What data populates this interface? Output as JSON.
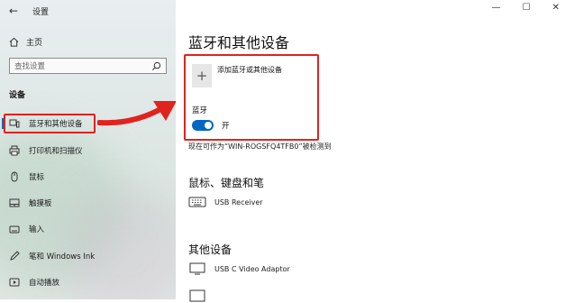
{
  "window": {
    "title": "设置",
    "back_glyph": "←",
    "controls": {
      "minimize": "—",
      "maximize": "☐",
      "close": "✕"
    }
  },
  "sidebar": {
    "home_label": "主页",
    "search_placeholder": "查找设置",
    "section": "设备",
    "items": [
      {
        "label": "蓝牙和其他设备",
        "icon": "bluetooth-devices-icon",
        "selected": true
      },
      {
        "label": "打印机和扫描仪",
        "icon": "printer-icon"
      },
      {
        "label": "鼠标",
        "icon": "mouse-icon"
      },
      {
        "label": "触摸板",
        "icon": "touchpad-icon"
      },
      {
        "label": "输入",
        "icon": "keyboard-icon"
      },
      {
        "label": "笔和 Windows Ink",
        "icon": "pen-icon"
      },
      {
        "label": "自动播放",
        "icon": "autoplay-icon"
      }
    ]
  },
  "main": {
    "title": "蓝牙和其他设备",
    "add_device_label": "添加蓝牙或其他设备",
    "bluetooth_label": "蓝牙",
    "bluetooth_state": "开",
    "bluetooth_on": true,
    "discoverable_text": "现在可作为“WIN-ROGSFQ4TFB0”被检测到",
    "mouse_keyboard_pen_heading": "鼠标、键盘和笔",
    "mouse_keyboard_devices": [
      "USB Receiver"
    ],
    "other_devices_heading": "其他设备",
    "other_devices": [
      "USB C Video Adaptor"
    ]
  },
  "colors": {
    "accent": "#0067c0",
    "annotation_red": "#e0231e"
  }
}
